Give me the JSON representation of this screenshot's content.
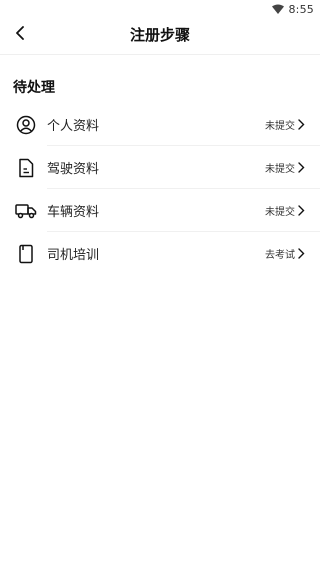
{
  "status_bar": {
    "time": "8:55",
    "wifi_icon": "wifi-icon"
  },
  "header": {
    "title": "注册步骤",
    "back_icon": "chevron-left-icon"
  },
  "section": {
    "title": "待处理"
  },
  "items": [
    {
      "label": "个人资料",
      "status": "未提交",
      "icon": "user-circle-icon"
    },
    {
      "label": "驾驶资料",
      "status": "未提交",
      "icon": "document-icon"
    },
    {
      "label": "车辆资料",
      "status": "未提交",
      "icon": "truck-icon"
    },
    {
      "label": "司机培训",
      "status": "去考试",
      "icon": "book-icon"
    }
  ]
}
